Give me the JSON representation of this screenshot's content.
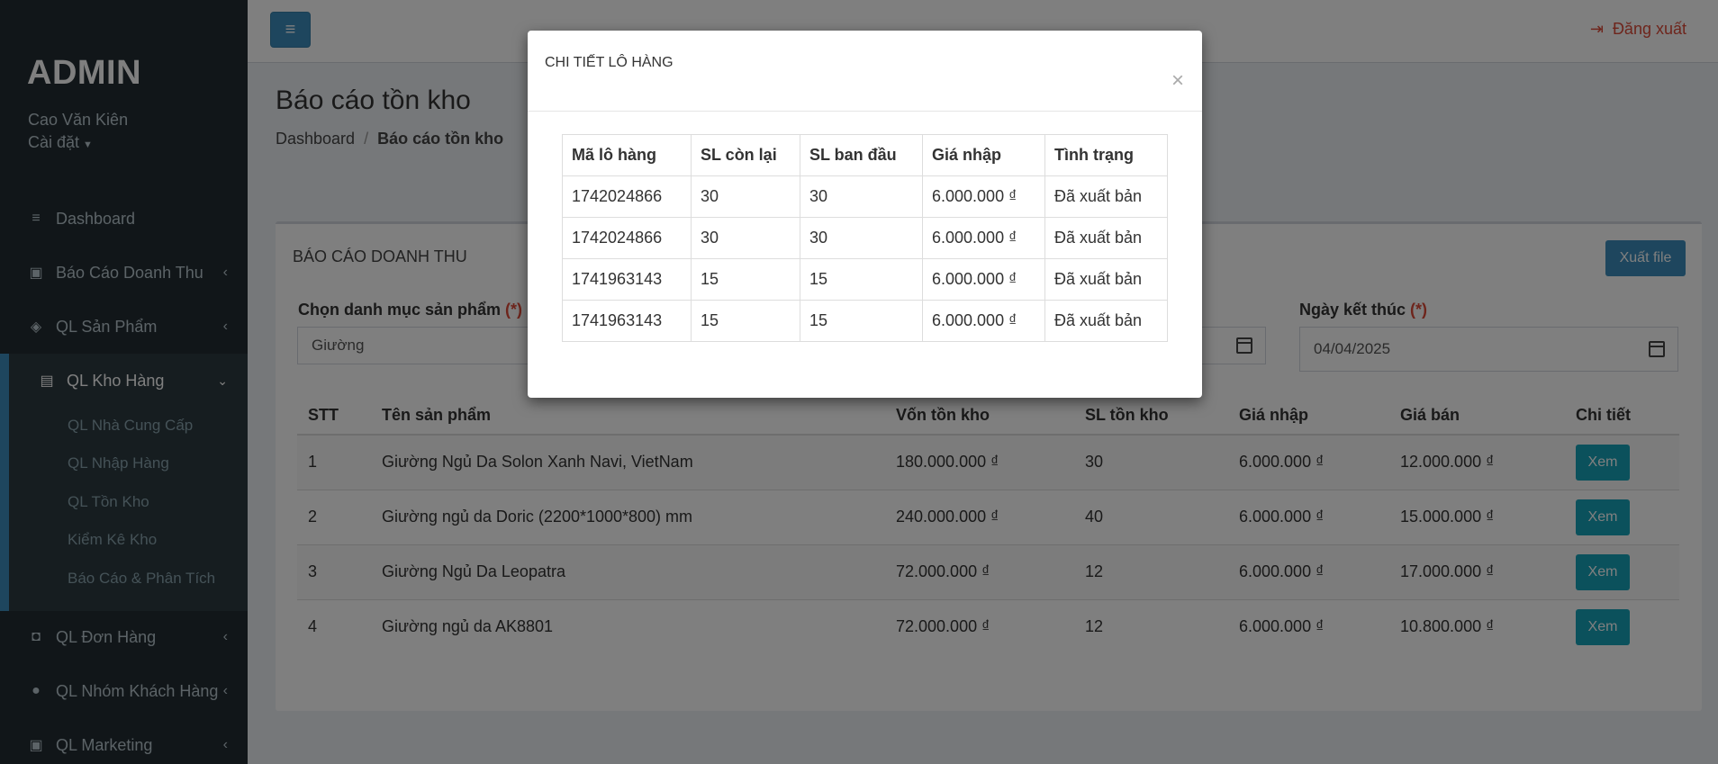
{
  "sidebar": {
    "brand": "ADMIN",
    "user_name": "Cao Văn Kiên",
    "settings_label": "Cài đặt",
    "menu": [
      {
        "label": "Dashboard"
      },
      {
        "label": "Báo Cáo Doanh Thu"
      },
      {
        "label": "QL Sản Phẩm"
      },
      {
        "label": "QL Kho Hàng"
      },
      {
        "label": "QL Đơn Hàng"
      },
      {
        "label": "QL Nhóm Khách Hàng"
      },
      {
        "label": "QL Marketing"
      }
    ],
    "submenu": [
      "QL Nhà Cung Cấp",
      "QL Nhập Hàng",
      "QL Tồn Kho",
      "Kiểm Kê Kho",
      "Báo Cáo & Phân Tích"
    ]
  },
  "topbar": {
    "logout_label": "Đăng xuất"
  },
  "header": {
    "title": "Báo cáo tồn kho",
    "breadcrumb": [
      "Dashboard",
      "Báo cáo tồn kho"
    ]
  },
  "box": {
    "title": "BÁO CÁO DOANH THU",
    "export_label": "Xuất file",
    "category_label": "Chọn danh mục sản phẩm",
    "category_value": "Giường",
    "end_date_label": "Ngày kết thúc",
    "end_date_value": "04/04/2025",
    "required_mark": "(*)"
  },
  "table": {
    "headers": [
      "STT",
      "Tên sản phẩm",
      "Vốn tồn kho",
      "SL tồn kho",
      "Giá nhập",
      "Giá bán",
      "Chi tiết"
    ],
    "rows": [
      [
        "1",
        "Giường Ngủ Da Solon Xanh Navi, VietNam",
        "180.000.000 ₫",
        "30",
        "6.000.000 ₫",
        "12.000.000 ₫"
      ],
      [
        "2",
        "Giường ngủ da Doric (2200*1000*800) mm",
        "240.000.000 ₫",
        "40",
        "6.000.000 ₫",
        "15.000.000 ₫"
      ],
      [
        "3",
        "Giường Ngủ Da Leopatra",
        "72.000.000 ₫",
        "12",
        "6.000.000 ₫",
        "17.000.000 ₫"
      ],
      [
        "4",
        "Giường ngủ da AK8801",
        "72.000.000 ₫",
        "12",
        "6.000.000 ₫",
        "10.800.000 ₫"
      ]
    ],
    "action_label": "Xem"
  },
  "modal": {
    "title": "CHI TIẾT LÔ HÀNG",
    "close": "×",
    "headers": [
      "Mã lô hàng",
      "SL còn lại",
      "SL ban đầu",
      "Giá nhập",
      "Tình trạng"
    ],
    "rows": [
      [
        "1742024866",
        "30",
        "30",
        "6.000.000 ₫",
        "Đã xuất bản"
      ],
      [
        "1742024866",
        "30",
        "30",
        "6.000.000 ₫",
        "Đã xuất bản"
      ],
      [
        "1741963143",
        "15",
        "15",
        "6.000.000 ₫",
        "Đã xuất bản"
      ],
      [
        "1741963143",
        "15",
        "15",
        "6.000.000 ₫",
        "Đã xuất bản"
      ]
    ]
  },
  "colors": {
    "sidebar": "#222d32",
    "primary": "#3c8dbc",
    "info": "#17a2b8",
    "danger": "#dd4b39"
  }
}
